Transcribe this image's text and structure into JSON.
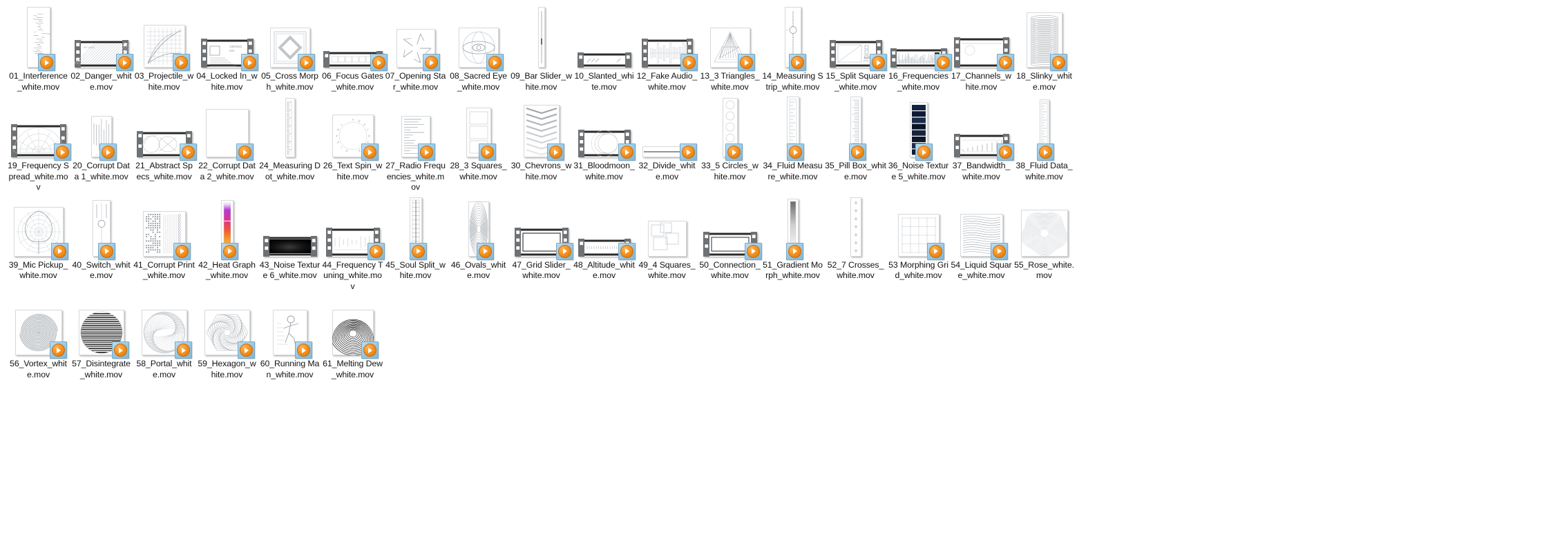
{
  "window": {
    "view_mode": "large-icons",
    "file_type": "mov",
    "overlay_icon": "play-badge-icon",
    "accent_color": "#f08a16",
    "badge_bg_color": "#94c6e4",
    "background_color": "#ffffff",
    "text_color": "#111111"
  },
  "files": [
    {
      "name": "01_Interference_white.mov",
      "thumb": "vertical-paper-scribble",
      "badge": true
    },
    {
      "name": "02_Danger_white.mov",
      "thumb": "filmstrip-hatched",
      "badge": true
    },
    {
      "name": "03_Projectile_white.mov",
      "thumb": "grid-curves",
      "badge": true
    },
    {
      "name": "04_Locked In_white.mov",
      "thumb": "filmstrip-locked",
      "badge": true
    },
    {
      "name": "05_Cross Morph_white.mov",
      "thumb": "square-diamond",
      "badge": true
    },
    {
      "name": "06_Focus Gates_white.mov",
      "thumb": "wide-filmstrip-cells",
      "badge": true
    },
    {
      "name": "07_Opening Star_white.mov",
      "thumb": "star-arrows",
      "badge": true
    },
    {
      "name": "08_Sacred Eye_white.mov",
      "thumb": "sacred-eye",
      "badge": true
    },
    {
      "name": "09_Bar Slider_white.mov",
      "thumb": "tall-bar-slider",
      "badge": false
    },
    {
      "name": "10_Slanted_white.mov",
      "thumb": "slanted-filmstrip",
      "badge": false
    },
    {
      "name": "12_Fake Audio_white.mov",
      "thumb": "filmstrip-waveform",
      "badge": true
    },
    {
      "name": "13_3 Triangles_white.mov",
      "thumb": "triangles",
      "badge": true
    },
    {
      "name": "14_Measuring Strip_white.mov",
      "thumb": "measuring-strip",
      "badge": true
    },
    {
      "name": "15_Split Square_white.mov",
      "thumb": "filmstrip-split-square",
      "badge": true
    },
    {
      "name": "16_Frequencies_white.mov",
      "thumb": "filmstrip-frequencies",
      "badge": true
    },
    {
      "name": "17_Channels_white.mov",
      "thumb": "filmstrip-channels",
      "badge": true
    },
    {
      "name": "18_Slinky_white.mov",
      "thumb": "slinky",
      "badge": true
    },
    {
      "name": "19_Frequency Spread_white.mov",
      "thumb": "filmstrip-radar",
      "badge": true
    },
    {
      "name": "20_Corrupt Data 1_white.mov",
      "thumb": "corrupt-lines",
      "badge": true
    },
    {
      "name": "21_Abstract Specs_white.mov",
      "thumb": "filmstrip-abstract",
      "badge": true
    },
    {
      "name": "22_Corrupt Data 2_white.mov",
      "thumb": "blank-page",
      "badge": true
    },
    {
      "name": "24_Measuring Dot_white.mov",
      "thumb": "ruler-vertical",
      "badge": false
    },
    {
      "name": "26_Text Spin_white.mov",
      "thumb": "text-spin",
      "badge": true
    },
    {
      "name": "27_Radio Frequencies_white.mov",
      "thumb": "radio-freq",
      "badge": true
    },
    {
      "name": "28_3 Squares_white.mov",
      "thumb": "three-squares",
      "badge": true
    },
    {
      "name": "30_Chevrons_white.mov",
      "thumb": "chevrons",
      "badge": true
    },
    {
      "name": "31_Bloodmoon_white.mov",
      "thumb": "filmstrip-moon",
      "badge": true
    },
    {
      "name": "32_Divide_white.mov",
      "thumb": "divide-arrow",
      "badge": true
    },
    {
      "name": "33_5 Circles_white.mov",
      "thumb": "five-circles",
      "badge": true
    },
    {
      "name": "34_Fluid Measure_white.mov",
      "thumb": "fluid-measure",
      "badge": true
    },
    {
      "name": "35_Pill Box_white.mov",
      "thumb": "pill-box-ruler",
      "badge": true
    },
    {
      "name": "36_Noise Texture 5_white.mov",
      "thumb": "noise-blocks",
      "badge": true
    },
    {
      "name": "37_Bandwidth_white.mov",
      "thumb": "filmstrip-bandwidth",
      "badge": true
    },
    {
      "name": "38_Fluid Data_white.mov",
      "thumb": "fluid-data",
      "badge": true
    },
    {
      "name": "39_Mic Pickup_white.mov",
      "thumb": "mic-polar",
      "badge": true
    },
    {
      "name": "40_Switch_white.mov",
      "thumb": "switch-lever",
      "badge": true
    },
    {
      "name": "41_Corrupt Print_white.mov",
      "thumb": "corrupt-print",
      "badge": true
    },
    {
      "name": "42_Heat Graph_white.mov",
      "thumb": "heat-gradient",
      "badge": true
    },
    {
      "name": "43_Noise Texture 6_white.mov",
      "thumb": "filmstrip-dark-noise",
      "badge": false
    },
    {
      "name": "44_Frequency Tuning_white.mov",
      "thumb": "filmstrip-tuning",
      "badge": true
    },
    {
      "name": "45_Soul Split_white.mov",
      "thumb": "soul-split",
      "badge": true
    },
    {
      "name": "46_Ovals_white.mov",
      "thumb": "ovals",
      "badge": true
    },
    {
      "name": "47_Grid Slider_white.mov",
      "thumb": "filmstrip-grid-slider",
      "badge": true
    },
    {
      "name": "48_Altitude_white.mov",
      "thumb": "filmstrip-altitude",
      "badge": true
    },
    {
      "name": "49_4 Squares_white.mov",
      "thumb": "four-squares",
      "badge": false
    },
    {
      "name": "50_Connection_white.mov",
      "thumb": "filmstrip-connection",
      "badge": true
    },
    {
      "name": "51_Gradient Morph_white.mov",
      "thumb": "gradient-morph",
      "badge": true
    },
    {
      "name": "52_7 Crosses_white.mov",
      "thumb": "seven-crosses",
      "badge": false
    },
    {
      "name": "53 Morphing Grid_white.mov",
      "thumb": "morphing-grid",
      "badge": true
    },
    {
      "name": "54_Liquid Square_white.mov",
      "thumb": "liquid-square",
      "badge": true
    },
    {
      "name": "55_Rose_white.mov",
      "thumb": "rose",
      "badge": false
    },
    {
      "name": "56_Vortex_white.mov",
      "thumb": "vortex",
      "badge": true
    },
    {
      "name": "57_Disintegrate_white.mov",
      "thumb": "disintegrate",
      "badge": true
    },
    {
      "name": "58_Portal_white.mov",
      "thumb": "portal",
      "badge": true
    },
    {
      "name": "59_Hexagon_white.mov",
      "thumb": "hexagon-spiral",
      "badge": true
    },
    {
      "name": "60_Running Man_white.mov",
      "thumb": "running-man",
      "badge": true
    },
    {
      "name": "61_Melting Dew_white.mov",
      "thumb": "melting-dew",
      "badge": true
    }
  ]
}
